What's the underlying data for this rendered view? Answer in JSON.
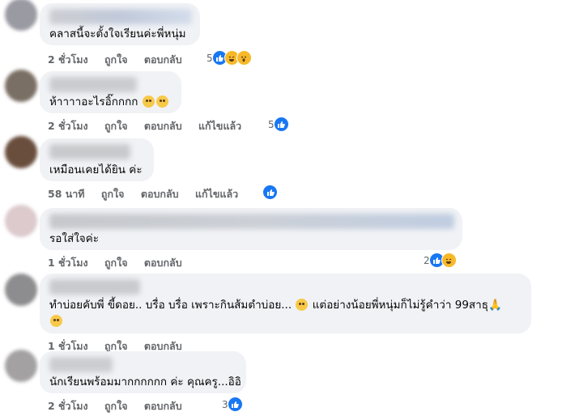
{
  "comments": [
    {
      "text": "คลาสนี้จะตั้งใจเรียนค่ะพี่หนุ่ม",
      "time": "2 ชั่วโมง",
      "like": "ถูกใจ",
      "reply": "ตอบกลับ",
      "edited": "",
      "reaction_count": "5",
      "reactions": [
        "like-icon",
        "haha-icon",
        "wow-icon"
      ],
      "avatar_color": "#9a9aa3"
    },
    {
      "text": "ห้าาาาอะไรอิ๊กกกก",
      "time": "2 ชั่วโมง",
      "like": "ถูกใจ",
      "reply": "ตอบกลับ",
      "edited": "แก้ไขแล้ว",
      "reaction_count": "5",
      "reactions": [
        "like-icon"
      ],
      "avatar_color": "#7a6f64"
    },
    {
      "text": "เหมือนเคยได้ยิน ค่ะ",
      "time": "58 นาที",
      "like": "ถูกใจ",
      "reply": "ตอบกลับ",
      "edited": "แก้ไขแล้ว",
      "reaction_count": "",
      "reactions": [
        "like-icon"
      ],
      "avatar_color": "#6a4e3d"
    },
    {
      "text": "รอใส่ใจค่ะ",
      "time": "1 ชั่วโมง",
      "like": "ถูกใจ",
      "reply": "ตอบกลับ",
      "edited": "",
      "reaction_count": "2",
      "reactions": [
        "like-icon",
        "haha-icon"
      ],
      "avatar_color": "#d9c9cc"
    },
    {
      "text_before": "ทำบ่อยคับพี่ ขี้ดอย.. บรื่อ บรื่อ เพราะกินส้มตำบ่อย...",
      "text_mid": " แต่อย่างน้อยพี่หนุ่มก็ไม่รู้คำว่า 99สาธุ",
      "time": "1 ชั่วโมง",
      "like": "ถูกใจ",
      "reply": "ตอบกลับ",
      "edited": "",
      "reaction_count": "",
      "reactions": [],
      "avatar_color": "#8d8d8f"
    },
    {
      "text": "นักเรียนพร้อมมากกกกกก ค่ะ คุณครู...อิอิ",
      "time": "2 ชั่วโมง",
      "like": "ถูกใจ",
      "reply": "ตอบกลับ",
      "edited": "",
      "reaction_count": "3",
      "reactions": [
        "like-icon"
      ],
      "avatar_color": "#a3a1a2"
    }
  ]
}
